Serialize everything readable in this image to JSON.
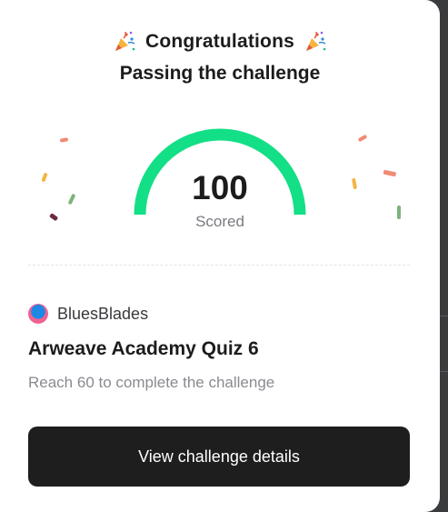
{
  "dialog": {
    "title": "Congratulations",
    "subtitle": "Passing the challenge",
    "title_icon": "party-popper-icon"
  },
  "result": {
    "score": "100",
    "score_label": "Scored",
    "gauge_fraction": 1.0
  },
  "challenge": {
    "creator": "BluesBlades",
    "name": "Arweave Academy Quiz 6",
    "requirement": "Reach 60 to complete the challenge"
  },
  "actions": {
    "view_details": "View challenge details"
  },
  "colors": {
    "gauge": "#13df86",
    "button_bg": "#1e1e1e",
    "confetti": [
      "#f08a75",
      "#f6b440",
      "#7db37a",
      "#6b2a3a"
    ]
  }
}
